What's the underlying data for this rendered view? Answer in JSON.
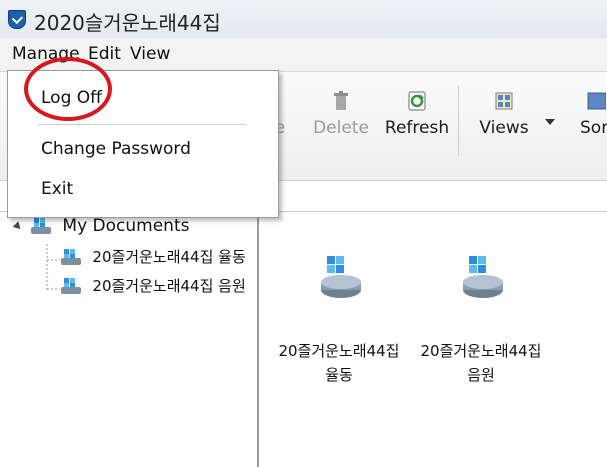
{
  "window": {
    "title": "2020슬거운노래44집"
  },
  "menubar": {
    "items": [
      "Manage",
      "Edit",
      "View"
    ]
  },
  "toolbar": {
    "partial_label": "e",
    "delete_label": "Delete",
    "refresh_label": "Refresh",
    "views_label": "Views",
    "sort_label": "Sor"
  },
  "manage_menu": {
    "items": [
      "Log Off",
      "Change Password",
      "Exit"
    ]
  },
  "tree": {
    "root": "My Documents",
    "children": [
      "20즐거운노래44집 율동",
      "20즐거운노래44집 음원"
    ]
  },
  "main": {
    "items": [
      {
        "line1": "20즐거운노래44집",
        "line2": "율동"
      },
      {
        "line1": "20즐거운노래44집",
        "line2": "음원"
      }
    ]
  },
  "colors": {
    "highlight_ring": "#d9171e",
    "accent": "#1e5fb0"
  }
}
